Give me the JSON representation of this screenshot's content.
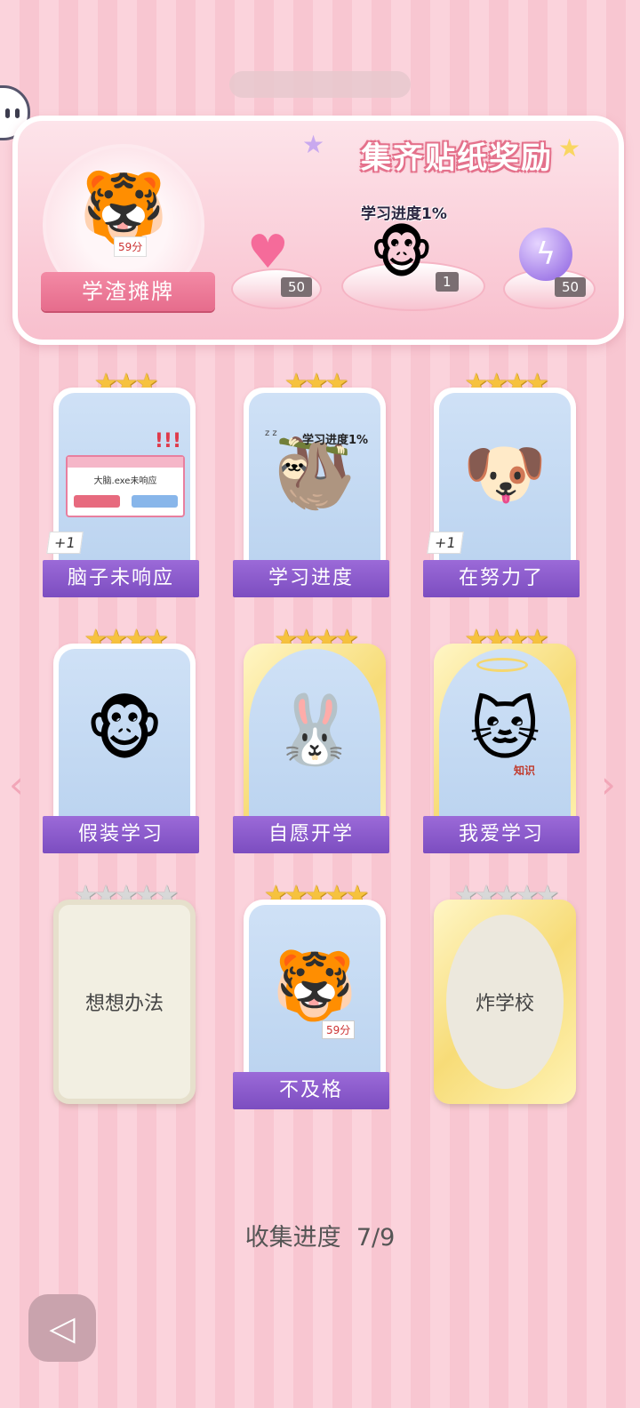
{
  "banner": {
    "title": "集齐贴纸奖励",
    "avatar_label": "学渣摊牌",
    "avatar_score": "59分",
    "progress_tag": "学习进度1%",
    "rewards": [
      {
        "icon": "pink-heart-gem-icon",
        "count": "50"
      },
      {
        "icon": "monkey-sticker-icon",
        "count": "1"
      },
      {
        "icon": "purple-lightning-orb-icon",
        "count": "50"
      }
    ]
  },
  "cards": [
    {
      "label": "脑子未响应",
      "stars": 3,
      "plus": "+1",
      "window_text": "大脑.exe未响应"
    },
    {
      "label": "学习进度",
      "stars": 3,
      "art_text": "学习进度1%"
    },
    {
      "label": "在努力了",
      "stars": 4,
      "plus": "+1"
    },
    {
      "label": "假装学习",
      "stars": 4
    },
    {
      "label": "自愿开学",
      "stars": 4
    },
    {
      "label": "我爱学习",
      "stars": 4,
      "art_text": "知识"
    },
    {
      "label": "想想办法",
      "stars": 5,
      "locked": true
    },
    {
      "label": "不及格",
      "stars": 5,
      "art_text": "59分"
    },
    {
      "label": "炸学校",
      "stars": 5,
      "locked": true
    }
  ],
  "collection": {
    "label": "收集进度",
    "value": "7/9"
  }
}
